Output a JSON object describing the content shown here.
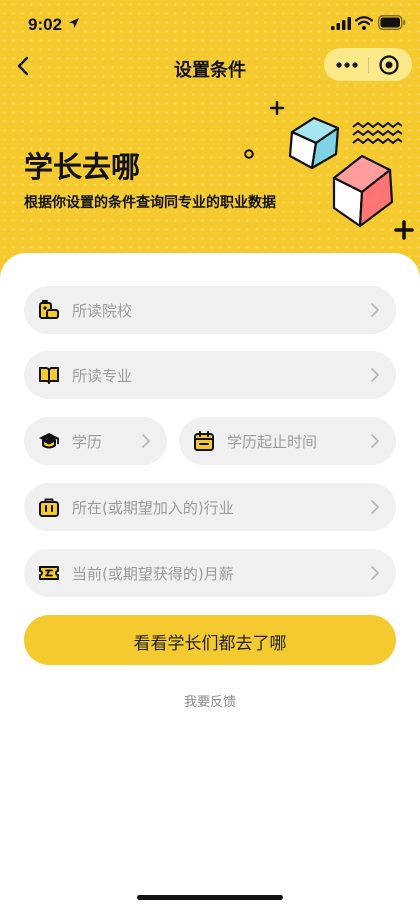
{
  "status_bar": {
    "time": "9:02"
  },
  "nav": {
    "title": "设置条件"
  },
  "hero": {
    "title": "学长去哪",
    "subtitle": "根据你设置的条件查询同专业的职业数据"
  },
  "form": {
    "school": {
      "placeholder": "所读院校",
      "icon": "school-icon"
    },
    "major": {
      "placeholder": "所读专业",
      "icon": "book-icon"
    },
    "degree": {
      "placeholder": "学历",
      "icon": "graduation-cap-icon"
    },
    "period": {
      "placeholder": "学历起止时间",
      "icon": "calendar-icon"
    },
    "industry": {
      "placeholder": "所在(或期望加入的)行业",
      "icon": "briefcase-icon"
    },
    "salary": {
      "placeholder": "当前(或期望获得的)月薪",
      "icon": "ticket-icon"
    }
  },
  "actions": {
    "submit_label": "看看学长们都去了哪",
    "feedback_label": "我要反馈"
  },
  "colors": {
    "brand_yellow": "#f5ca2e",
    "field_bg": "#f0f0f0",
    "placeholder": "#9b9b9b"
  }
}
